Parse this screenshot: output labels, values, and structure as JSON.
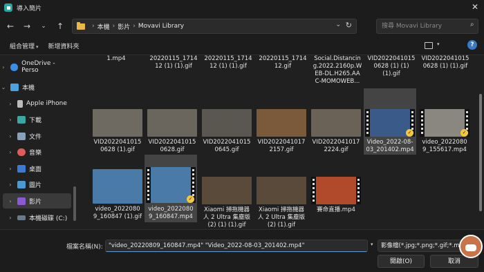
{
  "window": {
    "title": "導入簡片"
  },
  "address": {
    "crumbs": [
      "本機",
      "影片",
      "Movavi Library"
    ]
  },
  "search": {
    "placeholder": "搜尋 Movavi Library"
  },
  "commands": {
    "organize": "組合管理",
    "new_folder": "新增資料夾"
  },
  "sidebar": {
    "items": [
      {
        "label": "OneDrive - Perso",
        "icon_color": "#3a8ee6"
      },
      {
        "label": "本機",
        "icon_color": "#4aa3e0"
      },
      {
        "label": "Apple iPhone",
        "icon_color": "#bbbbbb"
      },
      {
        "label": "下載",
        "icon_color": "#3aa8a0"
      },
      {
        "label": "文件",
        "icon_color": "#8aa0b8"
      },
      {
        "label": "音樂",
        "icon_color": "#e05a5a"
      },
      {
        "label": "桌面",
        "icon_color": "#3a7bd5"
      },
      {
        "label": "圖片",
        "icon_color": "#4a9ad5"
      },
      {
        "label": "影片",
        "icon_color": "#8a5ad5"
      },
      {
        "label": "本機磁碟 (C:)",
        "icon_color": "#6a7a8a"
      }
    ]
  },
  "top_row": [
    "1.mp4",
    "20220115_1714\n12 (1) (1).gif",
    "20220115_1714\n12 (1) (1).gif",
    "20220115_1714\n12.gif",
    "Social.Distancin\ng.2022.2160p.W\nEB-DL.H265.AA\nC-MOMOWEB...",
    "VID2022041015\n0628 (1) (1)\n(1).gif",
    "VID2022041015\n0628 (1) (1).gif"
  ],
  "row2": [
    {
      "label": "VID2022041015\n0628 (1).gif",
      "color": "#6e6a62"
    },
    {
      "label": "VID2022041015\n0628.gif",
      "color": "#6a665e"
    },
    {
      "label": "VID2022041015\n0645.gif",
      "color": "#5a5650"
    },
    {
      "label": "VID2022041017\n2157.gif",
      "color": "#7a5a3a"
    },
    {
      "label": "VID2022041017\n2224.gif",
      "color": "#6a6256"
    },
    {
      "label": "Video_2022-08-\n03_201402.mp4",
      "color": "#3a5a8a"
    },
    {
      "label": "video_2022080\n9_155617.mp4",
      "color": "#8a8680"
    }
  ],
  "row3": [
    {
      "label": "video_2022080\n9_160847 (1).gif",
      "color": "#4a7aa8"
    },
    {
      "label": "video_2022080\n9_160847.mp4",
      "color": "#4a7aa8"
    },
    {
      "label": "Xiaomi 掃拖機器\n人 2 Ultra 集塵版\n(2) (1) (1).gif",
      "color": "#5a4a3a"
    },
    {
      "label": "Xiaomi 掃拖機器\n人 2 Ultra 集塵版\n(2) (1).gif",
      "color": "#5a4a3a"
    },
    {
      "label": "賽命直播.mp4",
      "color": "#b04a2a"
    }
  ],
  "footer": {
    "filename_label": "檔案名稱(N):",
    "filename_value": "\"video_20220809_160847.mp4\" \"Video_2022-08-03_201402.mp4\"",
    "filetype": "影像檔(*.jpg;*.png;*.gif;*.mov;",
    "open": "開啟(O)",
    "cancel": "取消"
  }
}
